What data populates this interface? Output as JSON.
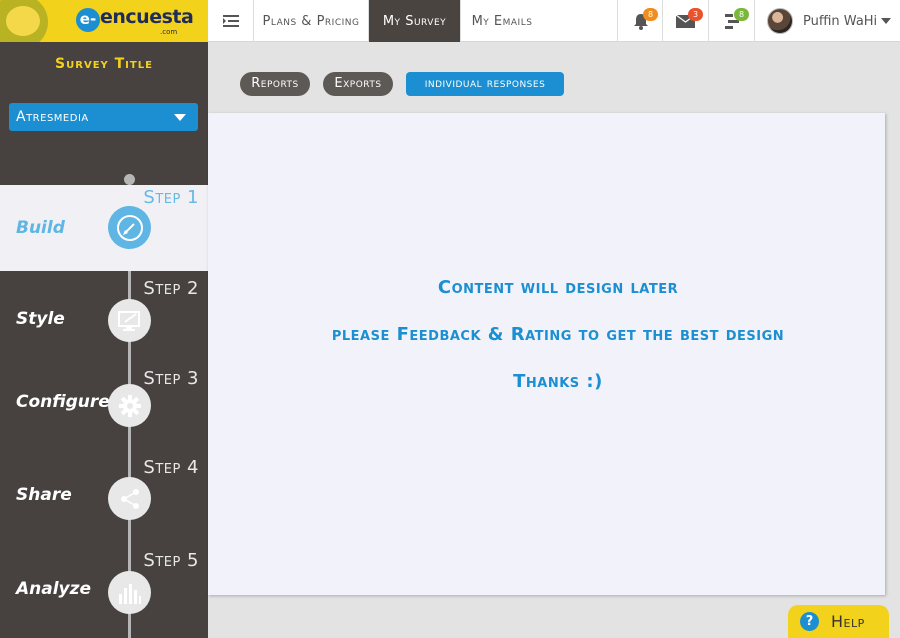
{
  "brand": {
    "logo_mark": "e-",
    "logo_text": "encuesta",
    "logo_tld": ".com"
  },
  "topnav": {
    "items": [
      {
        "label": "Plans & Pricing"
      },
      {
        "label": "My Survey"
      },
      {
        "label": "My Emails"
      }
    ],
    "notifications": [
      {
        "icon": "bell-icon",
        "count": "8",
        "color": "#f28c1e"
      },
      {
        "icon": "mail-icon",
        "count": "3",
        "color": "#e9522c"
      },
      {
        "icon": "tasks-icon",
        "count": "8",
        "color": "#7bb83a"
      }
    ],
    "user_name": "Puffin WaHi"
  },
  "sidebar": {
    "survey_title": "Survey Title",
    "selected_survey": "Atresmedia",
    "steps": [
      {
        "step_label": "Step 1",
        "name": "Build",
        "icon": "pencil-icon"
      },
      {
        "step_label": "Step 2",
        "name": "Style",
        "icon": "monitor-pen-icon"
      },
      {
        "step_label": "Step 3",
        "name": "Configure",
        "icon": "gear-icon"
      },
      {
        "step_label": "Step 4",
        "name": "Share",
        "icon": "share-icon"
      },
      {
        "step_label": "Step 5",
        "name": "Analyze",
        "icon": "bar-chart-icon"
      }
    ]
  },
  "main": {
    "tabs": [
      {
        "label": "Reports"
      },
      {
        "label": "Exports"
      },
      {
        "label": "individual responses"
      }
    ],
    "messages": [
      "Content will design later",
      "please Feedback & Rating to get the best design",
      "Thanks :)"
    ]
  },
  "help": {
    "label": "Help",
    "icon_glyph": "?"
  },
  "colors": {
    "brand_yellow": "#f2d21b",
    "accent_blue": "#1b8fd1",
    "sidebar_dark": "#474240"
  }
}
